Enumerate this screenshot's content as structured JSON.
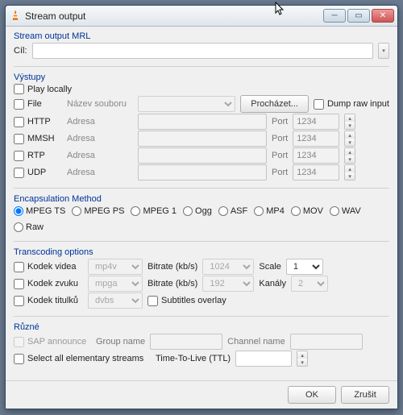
{
  "window": {
    "title": "Stream output"
  },
  "mrl": {
    "group": "Stream output MRL",
    "cil_label": "Cíl:",
    "cil_value": ""
  },
  "outputs": {
    "group": "Výstupy",
    "play_locally": "Play locally",
    "file": {
      "label": "File",
      "name_label": "Název souboru",
      "value": "",
      "browse": "Procházet...",
      "dump": "Dump raw input"
    },
    "http": {
      "label": "HTTP",
      "addr_label": "Adresa",
      "addr": "",
      "port_label": "Port",
      "port": "1234"
    },
    "mmsh": {
      "label": "MMSH",
      "addr_label": "Adresa",
      "addr": "",
      "port_label": "Port",
      "port": "1234"
    },
    "rtp": {
      "label": "RTP",
      "addr_label": "Adresa",
      "addr": "",
      "port_label": "Port",
      "port": "1234"
    },
    "udp": {
      "label": "UDP",
      "addr_label": "Adresa",
      "addr": "",
      "port_label": "Port",
      "port": "1234"
    }
  },
  "encaps": {
    "group": "Encapsulation Method",
    "options": [
      "MPEG TS",
      "MPEG PS",
      "MPEG 1",
      "Ogg",
      "ASF",
      "MP4",
      "MOV",
      "WAV",
      "Raw"
    ],
    "selected": "MPEG TS"
  },
  "trans": {
    "group": "Transcoding options",
    "video": {
      "label": "Kodek videa",
      "codec": "mp4v",
      "bitrate_label": "Bitrate (kb/s)",
      "bitrate": "1024",
      "scale_label": "Scale",
      "scale": "1"
    },
    "audio": {
      "label": "Kodek zvuku",
      "codec": "mpga",
      "bitrate_label": "Bitrate (kb/s)",
      "bitrate": "192",
      "chan_label": "Kanály",
      "chan": "2"
    },
    "sub": {
      "label": "Kodek titulků",
      "codec": "dvbs",
      "overlay": "Subtitles overlay"
    }
  },
  "misc": {
    "group": "Různé",
    "sap": "SAP announce",
    "groupname": "Group name",
    "chname": "Channel name",
    "selectall": "Select all elementary streams",
    "ttl_label": "Time-To-Live (TTL)",
    "ttl": ""
  },
  "buttons": {
    "ok": "OK",
    "cancel": "Zrušit"
  }
}
